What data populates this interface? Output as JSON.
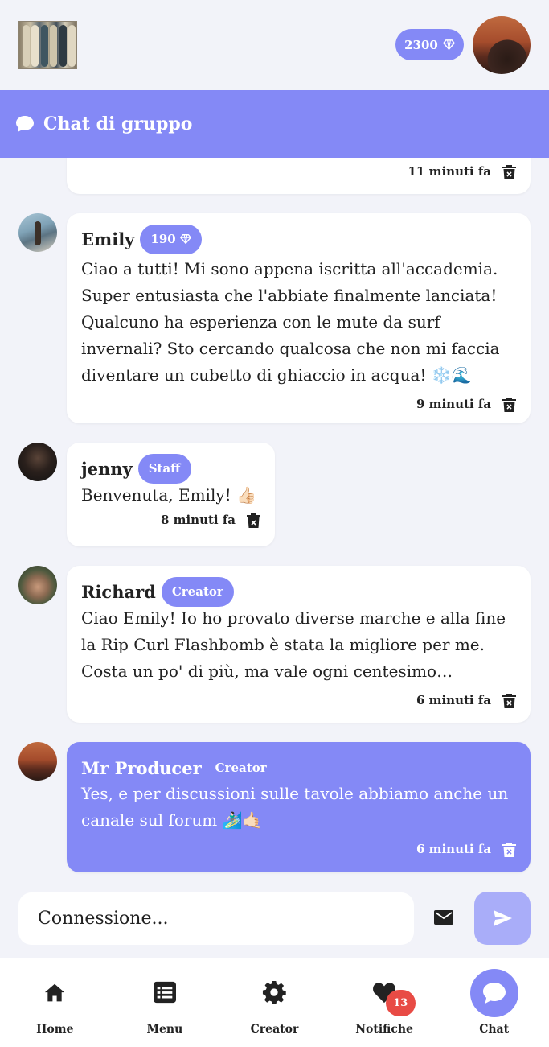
{
  "header": {
    "gems_count": "2300",
    "logo_icon": "surfboards-logo-icon",
    "gem_icon": "diamond-icon"
  },
  "chat_header": {
    "title": "Chat di gruppo",
    "icon": "chat-bubble-icon"
  },
  "messages": [
    {
      "author": "",
      "badge": "",
      "text": "",
      "time": "11 minuti fa",
      "partial": true
    },
    {
      "author": "Emily",
      "badge": "190",
      "badge_has_gem": true,
      "text": "Ciao a tutti! Mi sono appena iscritta all'accademia. Super entusiasta che l'abbiate finalmente lanciata! Qualcuno ha esperienza con le mute da surf invernali? Sto cercando qualcosa che non mi faccia diventare un cubetto di ghiaccio in acqua! ❄️🌊",
      "time": "9 minuti fa"
    },
    {
      "author": "jenny",
      "badge": "Staff",
      "text": "Benvenuta, Emily! 👍🏻",
      "time": "8 minuti fa"
    },
    {
      "author": "Richard",
      "badge": "Creator",
      "text": "Ciao Emily! Io ho provato diverse marche e alla fine la Rip Curl Flashbomb è stata la migliore per me. Costa un po' di più, ma vale ogni centesimo…",
      "time": "6 minuti fa"
    },
    {
      "author": "Mr Producer",
      "badge": "Creator",
      "text": "Yes, e per discussioni sulle tavole abbiamo anche un canale sul forum 🏄🏻‍♂️🤙🏻",
      "time": "6 minuti fa",
      "mine": true
    }
  ],
  "composer": {
    "placeholder": "Connessione...",
    "mail_icon": "mail-icon",
    "send_icon": "send-icon"
  },
  "nav": {
    "home": "Home",
    "menu": "Menu",
    "creator": "Creator",
    "notifications": "Notifiche",
    "notifications_count": "13",
    "chat": "Chat"
  },
  "colors": {
    "accent": "#8489f6",
    "background": "#f2f3f9",
    "badge_red": "#e84b45"
  }
}
